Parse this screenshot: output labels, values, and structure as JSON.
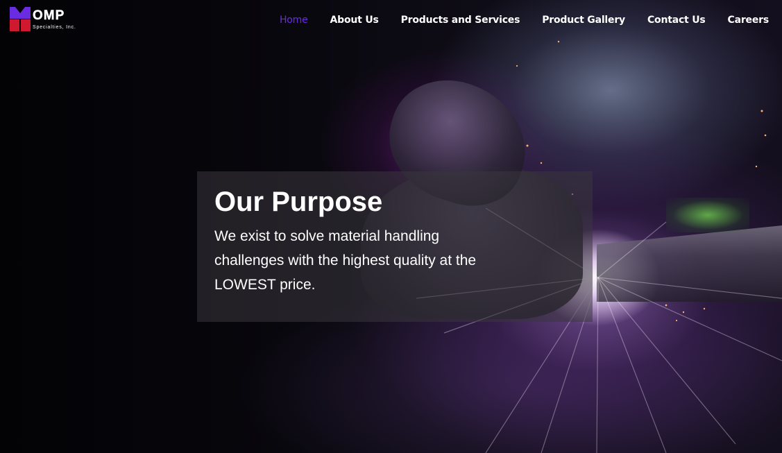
{
  "logo": {
    "name": "OMP",
    "subtitle": "Specialties, Inc.",
    "colors": {
      "purple": "#6a2ce0",
      "red": "#d0192f"
    }
  },
  "nav": {
    "items": [
      {
        "label": "Home",
        "active": true
      },
      {
        "label": "About Us",
        "active": false
      },
      {
        "label": "Products and Services",
        "active": false
      },
      {
        "label": "Product Gallery",
        "active": false
      },
      {
        "label": "Contact Us",
        "active": false
      },
      {
        "label": "Careers",
        "active": false
      }
    ],
    "active_color": "#6a2ce0"
  },
  "hero": {
    "title": "Our Purpose",
    "text": "We exist to solve material handling challenges with the highest quality at the LOWEST price."
  }
}
